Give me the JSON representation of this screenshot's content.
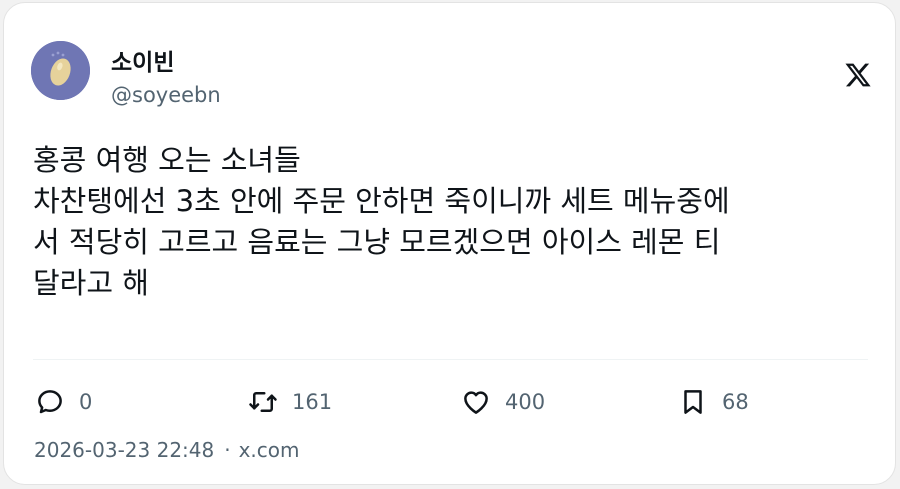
{
  "author": {
    "display_name": "소이빈",
    "handle": "@soyeebn",
    "avatar_icon": "bean-avatar-icon",
    "avatar_bg": "#6f76b4"
  },
  "brand": {
    "logo_icon": "x-logo-icon"
  },
  "tweet": {
    "lines": [
      "홍콩 여행 오는 소녀들",
      "차찬탱에선 3초 안에 주문 안하면 죽이니까 세트 메뉴중에",
      "서 적당히 고르고 음료는 그냥 모르겠으면 아이스 레몬 티",
      "달라고 해"
    ]
  },
  "actions": {
    "reply": {
      "icon": "reply-icon",
      "count": "0"
    },
    "retweet": {
      "icon": "retweet-icon",
      "count": "161"
    },
    "like": {
      "icon": "heart-icon",
      "count": "400"
    },
    "bookmark": {
      "icon": "bookmark-icon",
      "count": "68"
    }
  },
  "footer": {
    "timestamp": "2026-03-23 22:48",
    "separator": "·",
    "domain": "x.com"
  },
  "colors": {
    "text": "#0f1419",
    "muted": "#536471"
  }
}
